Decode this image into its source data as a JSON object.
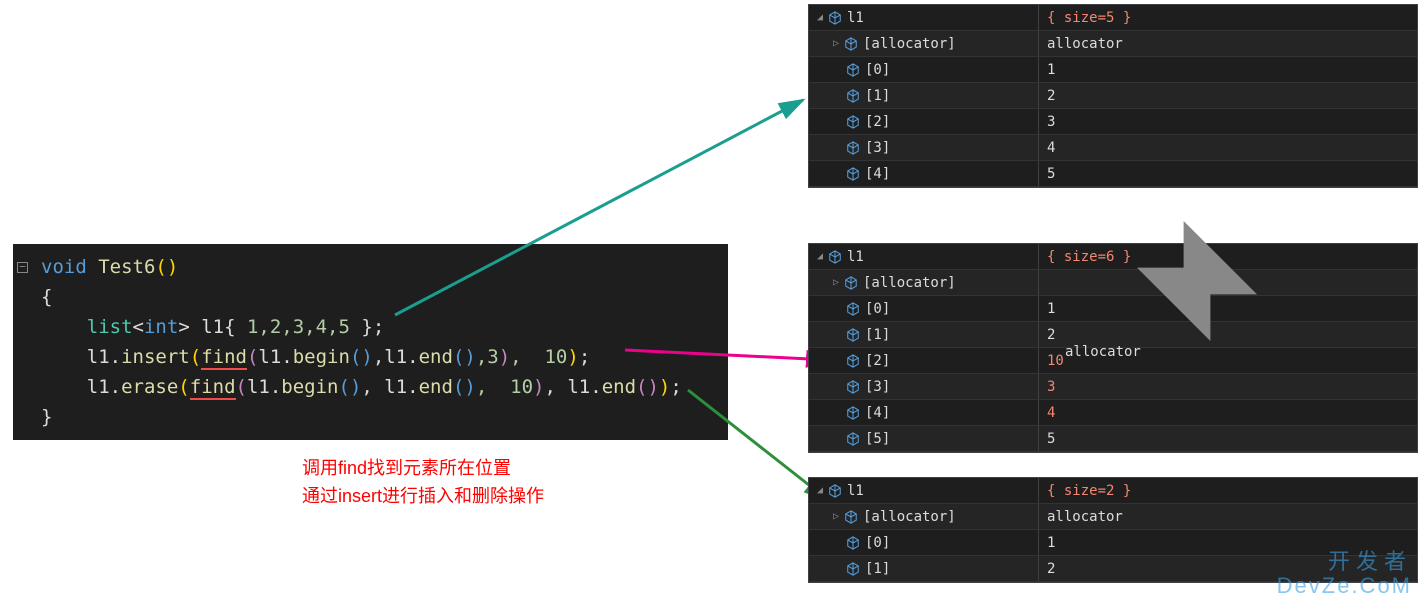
{
  "code": {
    "fn_decl_void": "void",
    "fn_decl_name": " Test6",
    "open_brace": "{",
    "close_brace": "}",
    "line1_list": "list",
    "line1_int": "int",
    "line1_var": " l1",
    "line1_nums": " 1,2,3,4,5 ",
    "line2_var": "l1.",
    "line2_insert": "insert",
    "line2_find": "find",
    "line2_begin": "begin",
    "line2_end": "end",
    "line2_l1": "l1.",
    "line2_c3": ",3",
    "line2_c10": ",  10",
    "line3_var": "l1.",
    "line3_erase": "erase",
    "line3_find": "find",
    "line3_begin": "begin",
    "line3_end": "end",
    "line3_l1": "l1.",
    "line3_c10": ",  10",
    "line3_l1end": ", l1.",
    "line3_end2": "end"
  },
  "annotation": {
    "line1": "调用find找到元素所在位置",
    "line2": "通过insert进行插入和删除操作"
  },
  "watch1": {
    "root": "l1",
    "root_value": "{ size=5 }",
    "allocator": "[allocator]",
    "allocator_value": "allocator",
    "items": [
      {
        "name": "[0]",
        "value": "1"
      },
      {
        "name": "[1]",
        "value": "2"
      },
      {
        "name": "[2]",
        "value": "3"
      },
      {
        "name": "[3]",
        "value": "4"
      },
      {
        "name": "[4]",
        "value": "5"
      }
    ]
  },
  "watch2": {
    "root": "l1",
    "root_value": "{ size=6 }",
    "allocator": "[allocator]",
    "allocator_value": "allocator",
    "items": [
      {
        "name": "[0]",
        "value": "1",
        "red": false
      },
      {
        "name": "[1]",
        "value": "2",
        "red": false
      },
      {
        "name": "[2]",
        "value": "10",
        "red": true
      },
      {
        "name": "[3]",
        "value": "3",
        "red": true
      },
      {
        "name": "[4]",
        "value": "4",
        "red": true
      },
      {
        "name": "[5]",
        "value": "5",
        "red": false
      }
    ]
  },
  "watch3": {
    "root": "l1",
    "root_value": "{ size=2 }",
    "allocator": "[allocator]",
    "allocator_value": "allocator",
    "items": [
      {
        "name": "[0]",
        "value": "1"
      },
      {
        "name": "[1]",
        "value": "2"
      }
    ]
  },
  "watermark": {
    "line1": "开发者",
    "line2": "DevZe.CoM"
  }
}
